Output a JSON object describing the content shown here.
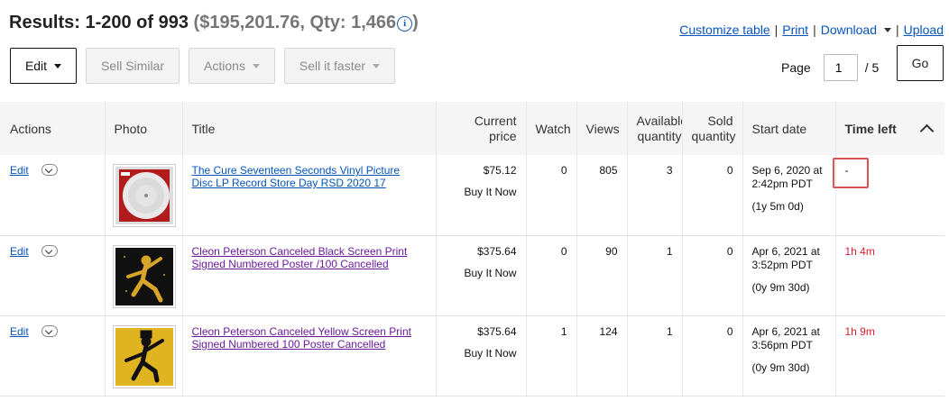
{
  "header": {
    "results_label": "Results: 1-200 of 993",
    "summary": "($195,201.76, Qty: 1,466",
    "summary_close": ")",
    "info_icon": "i"
  },
  "toplinks": {
    "customize": "Customize table",
    "print": "Print",
    "download": "Download",
    "upload": "Upload",
    "sep": "|"
  },
  "toolbar": {
    "edit": "Edit",
    "sell_similar": "Sell Similar",
    "actions": "Actions",
    "sell_faster": "Sell it faster"
  },
  "pager": {
    "label": "Page",
    "current": "1",
    "total": "/ 5",
    "go": "Go"
  },
  "columns": {
    "actions": "Actions",
    "photo": "Photo",
    "title": "Title",
    "price_1": "Current",
    "price_2": "price",
    "watch": "Watch",
    "views": "Views",
    "avail_1": "Available",
    "avail_2": "quantity",
    "sold_1": "Sold",
    "sold_2": "quantity",
    "start": "Start date",
    "time_left": "Time left"
  },
  "rows": [
    {
      "edit": "Edit",
      "title": "The Cure Seventeen Seconds Vinyl Picture Disc LP Record Store Day RSD 2020 17",
      "price": "$75.12",
      "format": "Buy It Now",
      "watch": "0",
      "views": "805",
      "available": "3",
      "sold": "0",
      "start_1": "Sep 6, 2020 at",
      "start_2": "2:42pm PDT",
      "duration": "(1y 5m 0d)",
      "time_left": "-"
    },
    {
      "edit": "Edit",
      "title": "Cleon Peterson Canceled Black Screen Print Signed Numbered Poster /100 Cancelled",
      "price": "$375.64",
      "format": "Buy It Now",
      "watch": "0",
      "views": "90",
      "available": "1",
      "sold": "0",
      "start_1": "Apr 6, 2021 at",
      "start_2": "3:52pm PDT",
      "duration": "(0y 9m 30d)",
      "time_left": "1h 4m"
    },
    {
      "edit": "Edit",
      "title": "Cleon Peterson Canceled Yellow Screen Print Signed Numbered 100 Poster Cancelled",
      "price": "$375.64",
      "format": "Buy It Now",
      "watch": "1",
      "views": "124",
      "available": "1",
      "sold": "0",
      "start_1": "Apr 6, 2021 at",
      "start_2": "3:56pm PDT",
      "duration": "(0y 9m 30d)",
      "time_left": "1h 9m"
    }
  ],
  "colors": {
    "link": "#0654ba",
    "visited": "#6a1b9a",
    "time_red": "#dd1e31",
    "highlight": "#d9534f"
  }
}
